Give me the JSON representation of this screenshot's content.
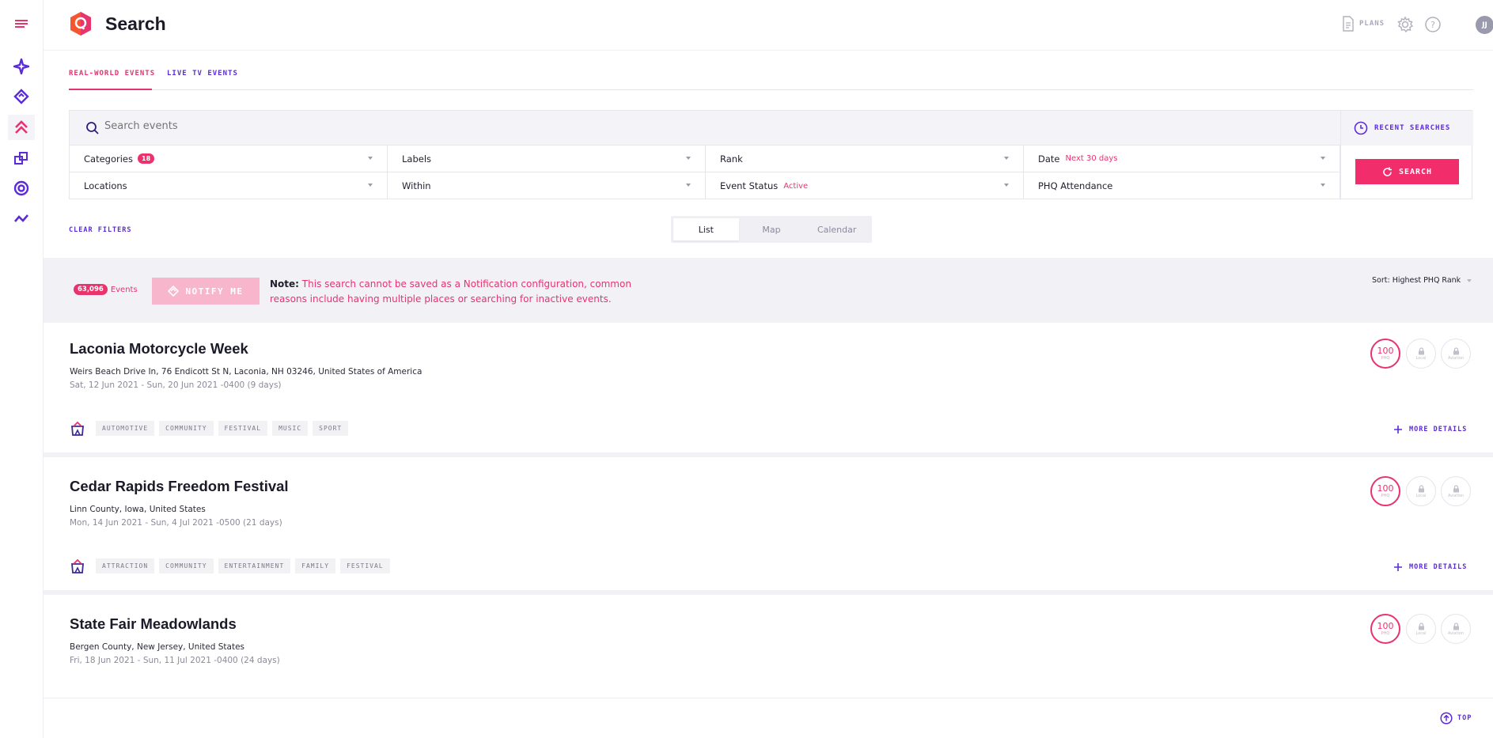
{
  "header": {
    "title": "Search",
    "plans_label": "PLANS",
    "avatar_initials": "JJ"
  },
  "tabs": [
    {
      "label": "REAL-WORLD EVENTS",
      "active": true
    },
    {
      "label": "LIVE TV EVENTS",
      "active": false
    }
  ],
  "search": {
    "placeholder": "Search events",
    "recent_label": "RECENT SEARCHES",
    "button_label": "SEARCH"
  },
  "filters": {
    "categories": {
      "label": "Categories",
      "badge": "18"
    },
    "labels": {
      "label": "Labels"
    },
    "rank": {
      "label": "Rank"
    },
    "date": {
      "label": "Date",
      "value": "Next 30 days"
    },
    "locations": {
      "label": "Locations"
    },
    "within": {
      "label": "Within"
    },
    "event_status": {
      "label": "Event Status",
      "value": "Active"
    },
    "phq_attendance": {
      "label": "PHQ Attendance"
    }
  },
  "clear_filters": "CLEAR FILTERS",
  "views": [
    "List",
    "Map",
    "Calendar"
  ],
  "notice": {
    "count": "63,096",
    "count_label": "Events",
    "notify_label": "NOTIFY ME",
    "note_label": "Note:",
    "note_text": "This search cannot be saved as a Notification configuration, common reasons include having multiple places or searching for inactive events.",
    "sort_label": "Sort: Highest PHQ Rank"
  },
  "events": [
    {
      "title": "Laconia Motorcycle Week",
      "address": "Weirs Beach Drive In, 76 Endicott St N, Laconia, NH 03246, United States of America",
      "dates": "Sat, 12 Jun 2021 - Sun, 20 Jun 2021 -0400 (9 days)",
      "tags": [
        "AUTOMOTIVE",
        "COMMUNITY",
        "FESTIVAL",
        "MUSIC",
        "SPORT"
      ],
      "phq_rank": "100"
    },
    {
      "title": "Cedar Rapids Freedom Festival",
      "address": "Linn County, Iowa, United States",
      "dates": "Mon, 14 Jun 2021 - Sun, 4 Jul 2021 -0500 (21 days)",
      "tags": [
        "ATTRACTION",
        "COMMUNITY",
        "ENTERTAINMENT",
        "FAMILY",
        "FESTIVAL"
      ],
      "phq_rank": "100"
    },
    {
      "title": "State Fair Meadowlands",
      "address": "Bergen County, New Jersey, United States",
      "dates": "Fri, 18 Jun 2021 - Sun, 11 Jul 2021 -0400 (24 days)",
      "tags": [],
      "phq_rank": "100"
    }
  ],
  "rank_labels": {
    "phq": "PHQ",
    "local": "Local",
    "aviation": "Aviation"
  },
  "more_details": "MORE DETAILS",
  "top_label": "TOP",
  "colors": {
    "accent": "#e8336d",
    "primary": "#5b2bd9"
  }
}
